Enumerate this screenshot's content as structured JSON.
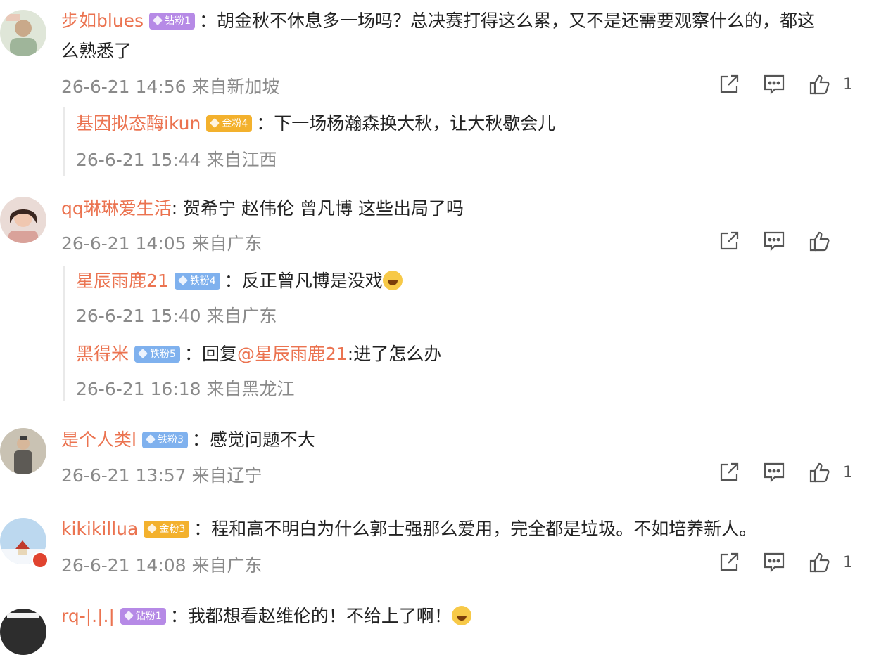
{
  "comments": [
    {
      "user": "步如blues",
      "badge": "钻粉1",
      "text_line1": "：胡金秋不休息多一场吗？总决赛打得这么累，又不是还需要观察什么的，都这",
      "text_line2": "么熟悉了",
      "meta": "26-6-21 14:56 来自新加坡",
      "likes": "1",
      "replies": [
        {
          "user": "基因拟态酶ikun",
          "badge": "金粉4",
          "text": "：下一场杨瀚森换大秋，让大秋歇会儿",
          "meta": "26-6-21 15:44 来自江西"
        }
      ]
    },
    {
      "user": "qq琳琳爱生活",
      "text": ": 贺希宁 赵伟伦 曾凡博 这些出局了吗",
      "meta": "26-6-21 14:05 来自广东",
      "replies": [
        {
          "user": "星辰雨鹿21",
          "badge": "铁粉4",
          "text": "：反正曾凡博是没戏",
          "meta": "26-6-21 15:40 来自广东"
        },
        {
          "user": "黑得米",
          "badge": "铁粉5",
          "text_prefix": "：回复",
          "mention": "@星辰雨鹿21",
          "text_suffix": ":进了怎么办",
          "meta": "26-6-21 16:18 来自黑龙江"
        }
      ]
    },
    {
      "user": "是个人类l",
      "badge": "铁粉3",
      "text": "：感觉问题不大",
      "meta": "26-6-21 13:57 来自辽宁",
      "likes": "1"
    },
    {
      "user": "kikikillua",
      "badge": "金粉3",
      "text": "：程和高不明白为什么郭士强那么爱用，完全都是垃圾。不如培养新人。",
      "meta": "26-6-21 14:08 来自广东",
      "likes": "1"
    },
    {
      "user": "rq-|.|.|",
      "badge": "钻粉1",
      "text": "：我都想看赵维伦的！不给上了啊！"
    }
  ],
  "icons": [
    "share-icon",
    "comment-icon",
    "like-icon",
    "laugh-cry-emoji"
  ],
  "colors": {
    "username": "#eb7350",
    "meta": "#8a8a8a",
    "badge_diamond": "#b68ae6",
    "badge_gold": "#f3b12d",
    "badge_iron": "#7fb1ee"
  }
}
